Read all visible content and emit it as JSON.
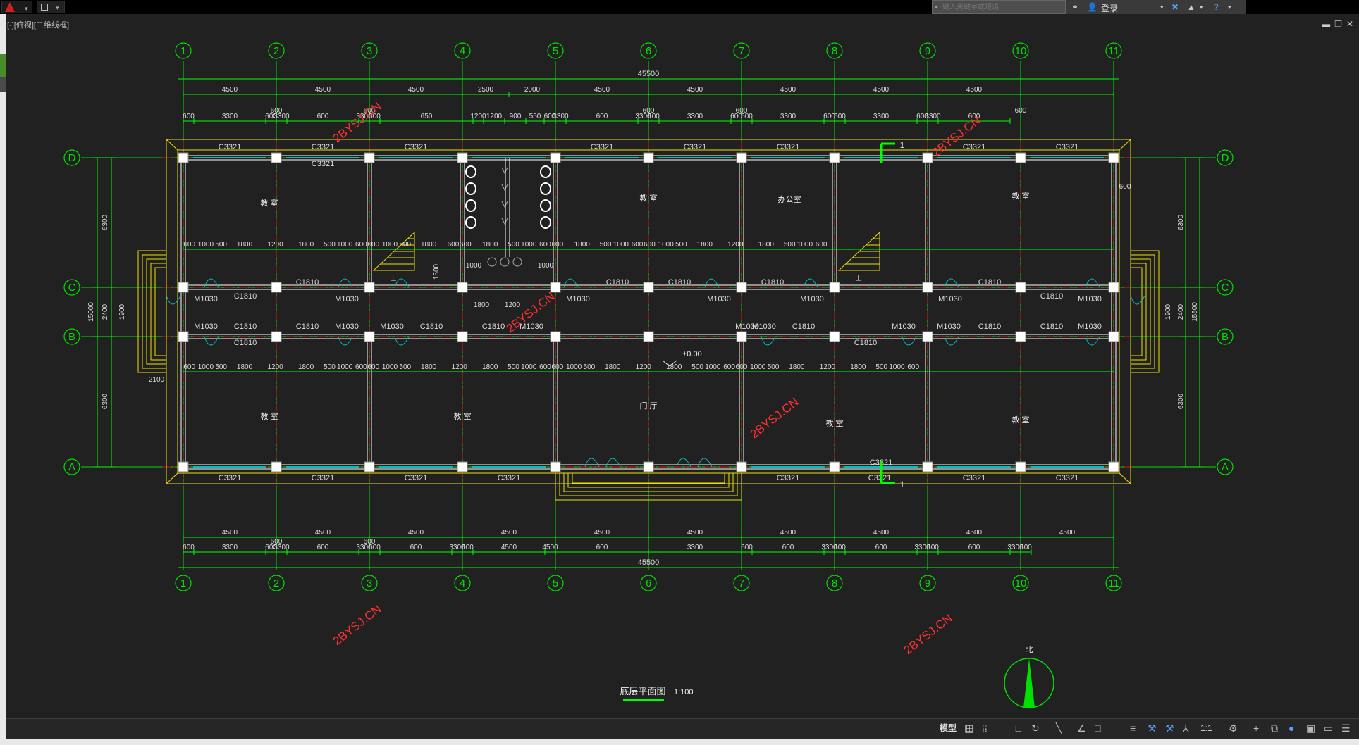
{
  "app": {
    "title_bar": {
      "search_placeholder": "键入关键字或短语",
      "login": "登录",
      "quick_access_icons": [
        "save-icon"
      ]
    }
  },
  "viewport": {
    "label": "[-][俯视][二维线框]"
  },
  "drawing": {
    "title": "底层平面图",
    "scale": "1:100",
    "north_label": "北",
    "watermark": "2BYSJ.CN",
    "column_axes": [
      "1",
      "2",
      "3",
      "4",
      "5",
      "6",
      "7",
      "8",
      "9",
      "10",
      "11"
    ],
    "row_axes": [
      "D",
      "C",
      "B",
      "A"
    ],
    "total_width": "45500",
    "bay_dims_top": [
      "4500",
      "4500",
      "4500",
      "2500",
      "2000",
      "4500",
      "4500",
      "4500",
      "4500",
      "4500"
    ],
    "top_detail_dims": [
      "600",
      "3300",
      "600",
      "3300",
      "600",
      "3300",
      "600",
      "650",
      "1200",
      "1200",
      "900",
      "550",
      "600",
      "3300",
      "600",
      "3300",
      "600",
      "3300",
      "600",
      "600",
      "3300",
      "600",
      "600",
      "3300",
      "600",
      "3300",
      "600"
    ],
    "top_offset_labels": [
      "600",
      "600",
      "600",
      "600",
      "600"
    ],
    "bay_dims_bottom": [
      "4500",
      "4500",
      "4500",
      "4500",
      "4500",
      "4500",
      "4500",
      "4500",
      "4500",
      "4500"
    ],
    "bottom_detail_dims": [
      "600",
      "3300",
      "600",
      "3300",
      "600",
      "3300",
      "600",
      "600",
      "3300",
      "600",
      "4500",
      "4500",
      "600",
      "3300",
      "600",
      "600",
      "3300",
      "600",
      "600",
      "3300",
      "600",
      "600",
      "3300",
      "600"
    ],
    "bottom_offset_labels": [
      "600",
      "600"
    ],
    "left_dims": {
      "d_c": "6300",
      "c_b": "2400",
      "b_a": "6300",
      "total": "15000",
      "inner_door": "1900",
      "stair_off": "2100"
    },
    "right_dims": {
      "d_c": "6300",
      "c_b": "2400",
      "b_a": "6300",
      "total": "15500",
      "inner_door": "1900",
      "top_off": "600"
    },
    "corridor_dims_top": [
      "600",
      "1000",
      "500",
      "1800",
      "1200",
      "1800",
      "500",
      "1000",
      "600",
      "600",
      "1000",
      "500",
      "1800",
      "600",
      "600",
      "1800",
      "500",
      "1000",
      "600",
      "600",
      "1800",
      "500",
      "1000",
      "600",
      "600",
      "1000",
      "500",
      "1800",
      "1200",
      "1800",
      "500",
      "1000",
      "600"
    ],
    "corridor_dims_bottom": [
      "600",
      "1000",
      "500",
      "1800",
      "1200",
      "1800",
      "500",
      "1000",
      "600",
      "600",
      "1000",
      "500",
      "1800",
      "1200",
      "1800",
      "500",
      "1000",
      "600",
      "600",
      "1000",
      "500",
      "1800",
      "1200",
      "1800",
      "500",
      "1000",
      "600",
      "600",
      "1000",
      "500",
      "1800",
      "1200",
      "1800",
      "500",
      "1000",
      "600"
    ],
    "wc_dims": {
      "left_w": "1000",
      "right_w": "1000",
      "h": "1500",
      "b1": "1800",
      "b2": "1200"
    },
    "windows_top": [
      "C3321",
      "C3321",
      "C3321",
      "C3321",
      "C3321",
      "C3321",
      "C3321",
      "C3321",
      "C3321"
    ],
    "windows_bottom": [
      "C3321",
      "C3321",
      "C3321",
      "C3321",
      "C3321",
      "C3321",
      "C3321",
      "C3321",
      "C3321"
    ],
    "corridor_windows": [
      "C1810",
      "C1810",
      "C1810",
      "C1810",
      "C1810",
      "C1810",
      "C1810",
      "C1810",
      "C1810",
      "C1810",
      "C1810",
      "C1810",
      "C1810",
      "C1810",
      "C1810",
      "C1810"
    ],
    "doors": [
      "M1030",
      "M1030",
      "M1030",
      "M1030",
      "M1030",
      "M1030",
      "M1030",
      "M1030",
      "M1030",
      "M1030",
      "M1030",
      "M1030",
      "M1030",
      "M1030",
      "M1030",
      "M1030"
    ],
    "rooms": [
      "教 室",
      "教 室",
      "办公室",
      "教 室",
      "教 室",
      "教 室",
      "门 厅",
      "教 室",
      "教 室"
    ],
    "stair_label": "上",
    "elevation": "±0.00",
    "section_mark": "1"
  },
  "status_bar": {
    "model_tab": "模型",
    "scale": "1:1"
  },
  "colors": {
    "grid_axis": "#00e000",
    "wall": "#ffffff",
    "column": "#ffffff",
    "centerline": "#e01818",
    "window": "#00c0c0",
    "dim": "#00ff00",
    "outline": "#f0e000",
    "watermark": "#ff3030",
    "bg": "#212121"
  }
}
